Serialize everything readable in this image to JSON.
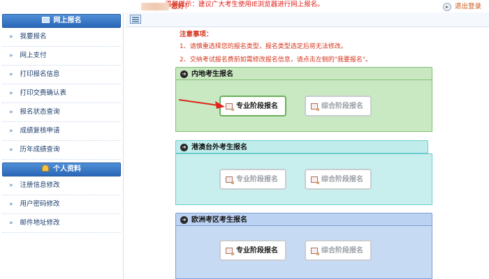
{
  "top_tip": "温馨提示：建议广大考生使用IE浏览器进行网上报名。",
  "sidebar": {
    "sections": [
      {
        "title": "网上报名",
        "items": [
          "我要报名",
          "网上支付",
          "打印报名信息",
          "打印交费确认表",
          "报名状态查询",
          "成绩复核申请",
          "历年成绩查询"
        ]
      },
      {
        "title": "个人资料",
        "items": [
          "注册信息修改",
          "用户密码修改",
          "邮件地址修改"
        ]
      }
    ]
  },
  "topbar": {
    "greeting": "您好！",
    "logout": "退出登录"
  },
  "notice": {
    "title": "注意事项：",
    "items": [
      "1、请慎重选择您的报名类型，报名类型选定后将无法修改。",
      "2、交纳考试报名费前如需修改报名信息，请点击左侧的\"我要报名\"。"
    ]
  },
  "panels": [
    {
      "title": "内地考生报名",
      "buttons": [
        "专业阶段报名",
        "综合阶段报名"
      ]
    },
    {
      "title": "港澳台外考生报名",
      "buttons": [
        "专业阶段报名",
        "综合阶段报名"
      ]
    },
    {
      "title": "欧洲考区考生报名",
      "buttons": [
        "专业阶段报名",
        "综合阶段报名"
      ]
    }
  ],
  "colors": {
    "accent_red": "#d4341b",
    "panel_mainland": "#c8e9c2",
    "panel_hk": "#c9eeee",
    "panel_europe": "#c7daf4"
  }
}
